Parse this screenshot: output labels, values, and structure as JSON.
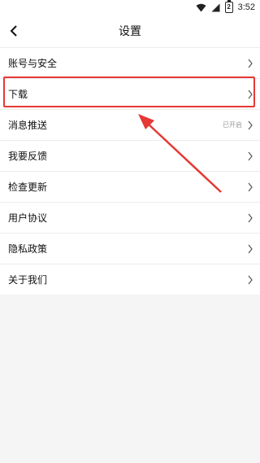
{
  "status_bar": {
    "time": "3:52",
    "battery_level": "2",
    "icons": [
      "wifi-icon",
      "signal-icon",
      "battery-icon"
    ]
  },
  "header": {
    "title": "设置",
    "back_icon": "chevron-left-icon"
  },
  "settings_items": [
    {
      "label": "账号与安全",
      "value": ""
    },
    {
      "label": "下载",
      "value": ""
    },
    {
      "label": "消息推送",
      "value": "已开启"
    },
    {
      "label": "我要反馈",
      "value": ""
    },
    {
      "label": "检查更新",
      "value": ""
    },
    {
      "label": "用户协议",
      "value": ""
    },
    {
      "label": "隐私政策",
      "value": ""
    },
    {
      "label": "关于我们",
      "value": ""
    }
  ],
  "annotation": {
    "color": "#e53935",
    "highlighted_item": "下载"
  }
}
